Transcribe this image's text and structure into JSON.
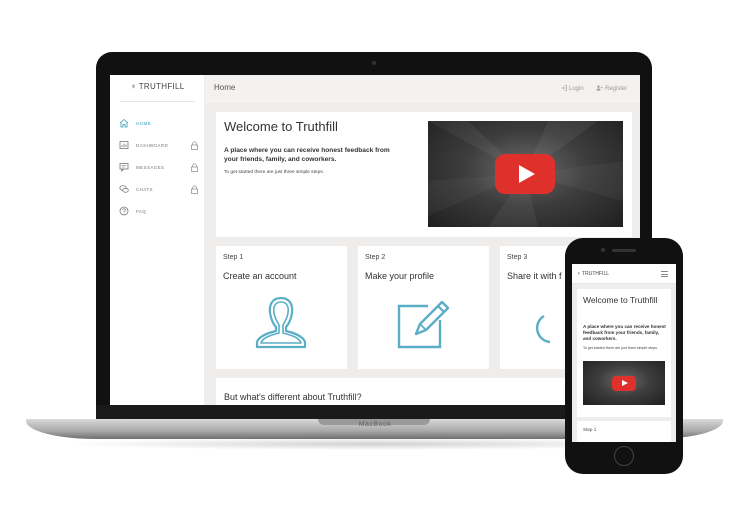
{
  "laptop": {
    "brand": "MacBook"
  },
  "app": {
    "logo": "TRUTHFILL",
    "page_title": "Home",
    "top_links": {
      "login": "Login",
      "register": "Register"
    },
    "nav": [
      {
        "label": "HOME",
        "icon": "home-icon",
        "locked": false,
        "active": true
      },
      {
        "label": "DASHBOARD",
        "icon": "dashboard-icon",
        "locked": true,
        "active": false
      },
      {
        "label": "MESSAGES",
        "icon": "messages-icon",
        "locked": true,
        "active": false
      },
      {
        "label": "CHATS",
        "icon": "chats-icon",
        "locked": true,
        "active": false
      },
      {
        "label": "FAQ",
        "icon": "help-icon",
        "locked": false,
        "active": false
      }
    ],
    "welcome": {
      "title": "Welcome to Truthfill",
      "subtitle": "A place where you can receive honest feedback from your friends, family, and coworkers.",
      "hint": "To get started there are just three simple steps."
    },
    "steps": [
      {
        "label": "Step 1",
        "title": "Create an account",
        "icon": "user-icon"
      },
      {
        "label": "Step 2",
        "title": "Make your profile",
        "icon": "edit-icon"
      },
      {
        "label": "Step 3",
        "title": "Share it with f",
        "icon": "share-icon"
      }
    ],
    "difference_title": "But what's different about Truthfill?"
  },
  "mobile": {
    "logo": "TRUTHFILL",
    "welcome": {
      "title": "Welcome to Truthfill",
      "subtitle": "A place where you can receive honest feedback from your friends, family, and coworkers.",
      "hint": "To get started there are just three simple steps."
    },
    "step_label": "Step 1"
  },
  "colors": {
    "accent": "#3a9fba",
    "youtube_red": "#e0302b",
    "panel_bg": "#eeedeb"
  }
}
